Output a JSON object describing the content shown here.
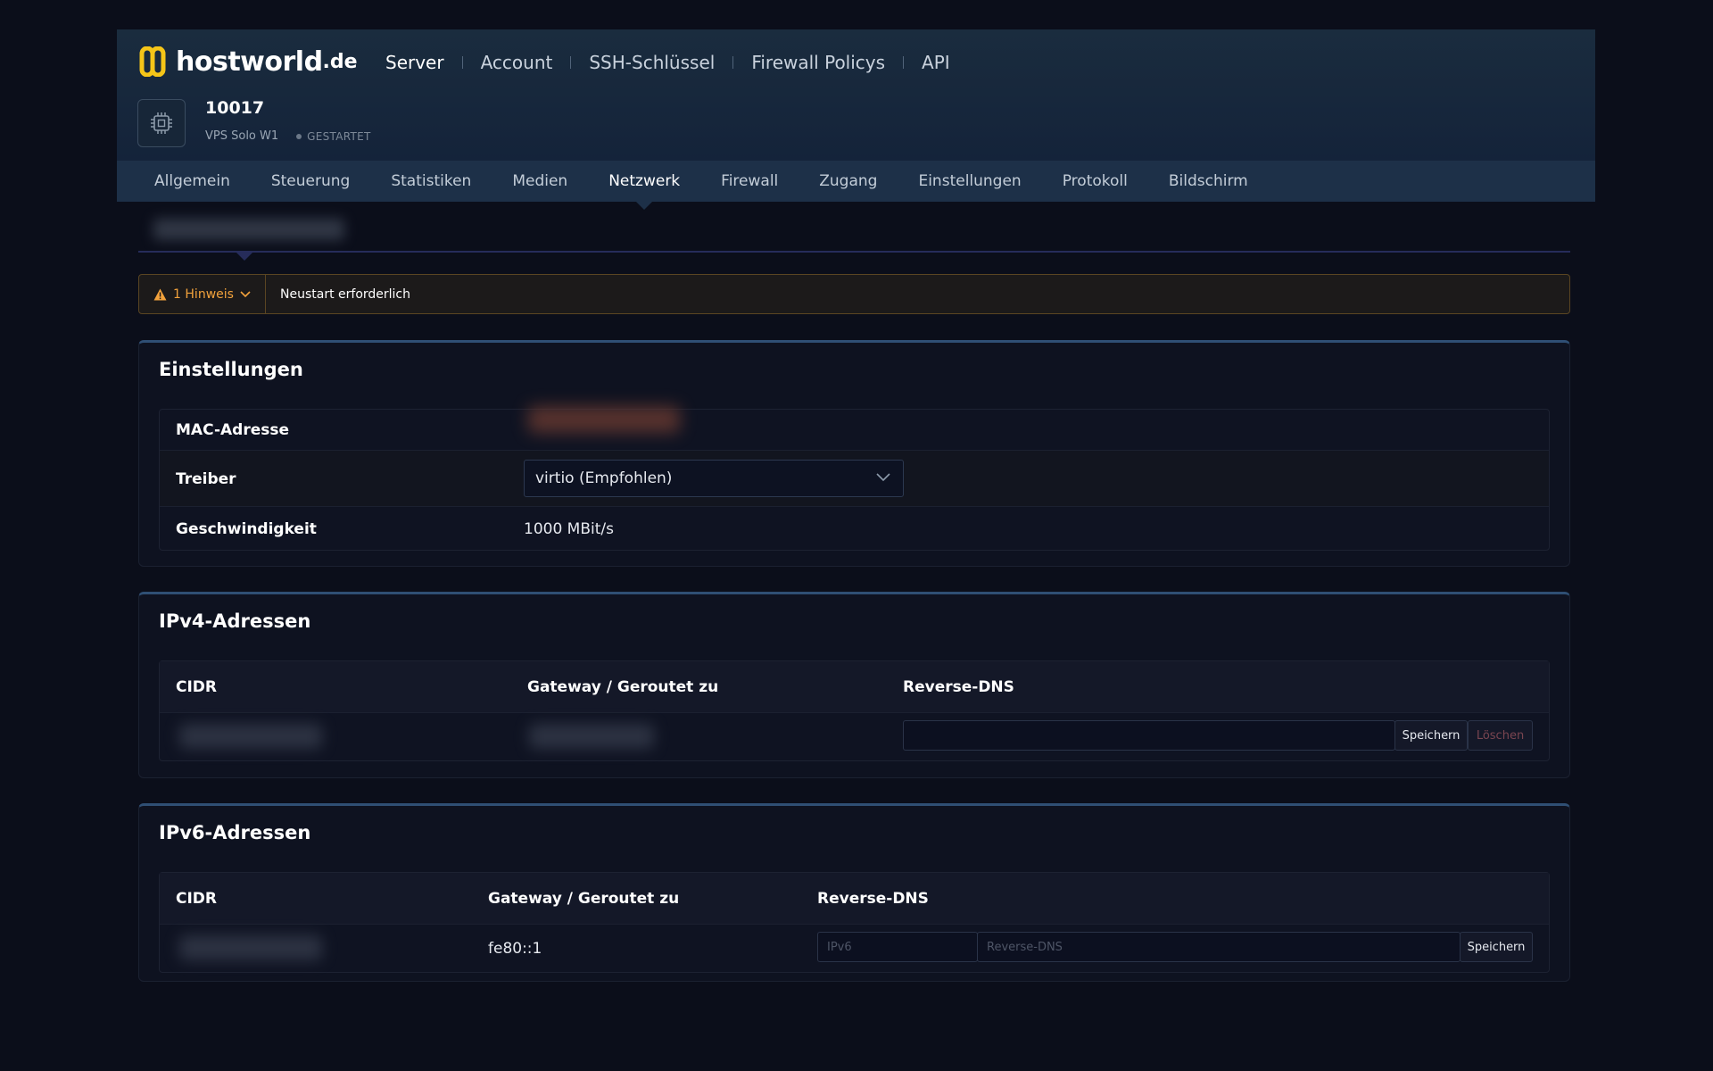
{
  "brand": {
    "name": "hostworld",
    "tld": ".de",
    "accent": "#f5c518"
  },
  "topnav": [
    "Server",
    "Account",
    "SSH-Schlüssel",
    "Firewall Policys",
    "API"
  ],
  "server": {
    "id": "10017",
    "plan": "VPS Solo W1",
    "status": "GESTARTET"
  },
  "tabs": [
    "Allgemein",
    "Steuerung",
    "Statistiken",
    "Medien",
    "Netzwerk",
    "Firewall",
    "Zugang",
    "Einstellungen",
    "Protokoll",
    "Bildschirm"
  ],
  "notice": {
    "badge": "1 Hinweis",
    "text": "Neustart erforderlich"
  },
  "settings": {
    "title": "Einstellungen",
    "mac_label": "MAC-Adresse",
    "driver_label": "Treiber",
    "driver_value": "virtio (Empfohlen)",
    "speed_label": "Geschwindigkeit",
    "speed_value": "1000 MBit/s"
  },
  "ipv4": {
    "title": "IPv4-Adressen",
    "headers": [
      "CIDR",
      "Gateway / Geroutet zu",
      "Reverse-DNS"
    ],
    "save_label": "Speichern",
    "delete_label": "Löschen"
  },
  "ipv6": {
    "title": "IPv6-Adressen",
    "headers": [
      "CIDR",
      "Gateway / Geroutet zu",
      "Reverse-DNS"
    ],
    "gateway": "fe80::1",
    "ip_placeholder": "IPv6",
    "rdns_placeholder": "Reverse-DNS",
    "save_label": "Speichern"
  }
}
